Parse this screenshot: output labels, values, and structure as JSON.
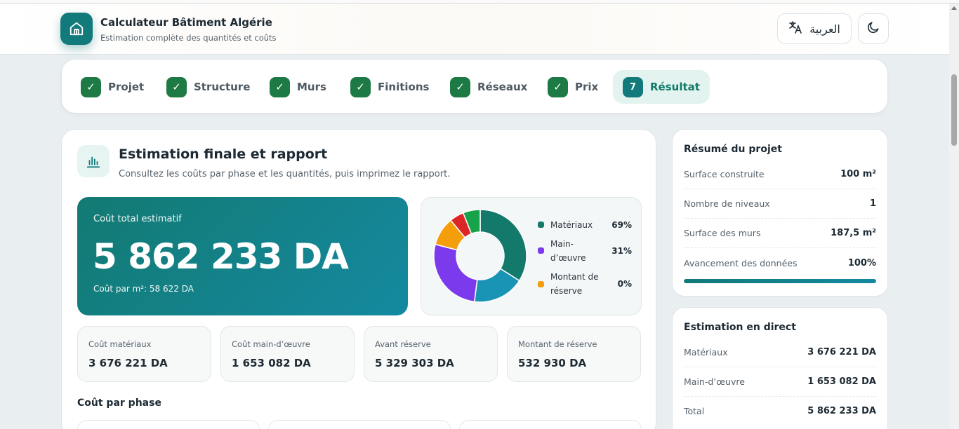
{
  "header": {
    "title": "Calculateur Bâtiment Algérie",
    "subtitle": "Estimation complète des quantités et coûts",
    "lang_label": "العربية",
    "logo_icon": "building-icon",
    "lang_icon": "translate-icon",
    "theme_icon": "moon-icon"
  },
  "steps": [
    {
      "num": "✓",
      "label": "Projet",
      "done": true
    },
    {
      "num": "✓",
      "label": "Structure",
      "done": true
    },
    {
      "num": "✓",
      "label": "Murs",
      "done": true
    },
    {
      "num": "✓",
      "label": "Finitions",
      "done": true
    },
    {
      "num": "✓",
      "label": "Réseaux",
      "done": true
    },
    {
      "num": "✓",
      "label": "Prix",
      "done": true
    },
    {
      "num": "7",
      "label": "Résultat",
      "done": false,
      "active": true
    }
  ],
  "section": {
    "title": "Estimation finale et rapport",
    "subtitle": "Consultez les coûts par phase et les quantités, puis imprimez le rapport.",
    "icon": "bar-chart-icon"
  },
  "total": {
    "label": "Coût total estimatif",
    "value": "5 862 233 DA",
    "per_m2": "Coût par m²: 58 622 DA"
  },
  "chart_data": {
    "type": "pie",
    "style": "donut",
    "legend": [
      {
        "name": "Matériaux",
        "pct": "69%",
        "color": "#137a6b"
      },
      {
        "name": "Main-d’œuvre",
        "pct": "31%",
        "color": "#7c3aed"
      },
      {
        "name": "Montant de réserve",
        "pct": "0%",
        "color": "#f59e0b"
      }
    ],
    "slices": [
      {
        "value": 34,
        "color": "#137a6b"
      },
      {
        "value": 18,
        "color": "#1a94b4"
      },
      {
        "value": 27,
        "color": "#7c3aed"
      },
      {
        "value": 10,
        "color": "#f59e0b"
      },
      {
        "value": 5,
        "color": "#dc2626"
      },
      {
        "value": 6,
        "color": "#16a34a"
      }
    ]
  },
  "mini_cards": [
    {
      "label": "Coût matériaux",
      "value": "3 676 221 DA"
    },
    {
      "label": "Coût main-d’œuvre",
      "value": "1 653 082 DA"
    },
    {
      "label": "Avant réserve",
      "value": "5 329 303 DA"
    },
    {
      "label": "Montant de réserve",
      "value": "532 930 DA"
    }
  ],
  "phase": {
    "title": "Coût par phase"
  },
  "summary": {
    "title": "Résumé du projet",
    "rows": [
      {
        "k": "Surface construite",
        "v": "100 m²"
      },
      {
        "k": "Nombre de niveaux",
        "v": "1"
      },
      {
        "k": "Surface des murs",
        "v": "187,5 m²"
      },
      {
        "k": "Avancement des données",
        "v": "100%"
      }
    ],
    "progress": 1.0
  },
  "live": {
    "title": "Estimation en direct",
    "rows": [
      {
        "k": "Matériaux",
        "v": "3 676 221 DA"
      },
      {
        "k": "Main-d’œuvre",
        "v": "1 653 082 DA"
      },
      {
        "k": "Total",
        "v": "5 862 233 DA"
      }
    ]
  }
}
